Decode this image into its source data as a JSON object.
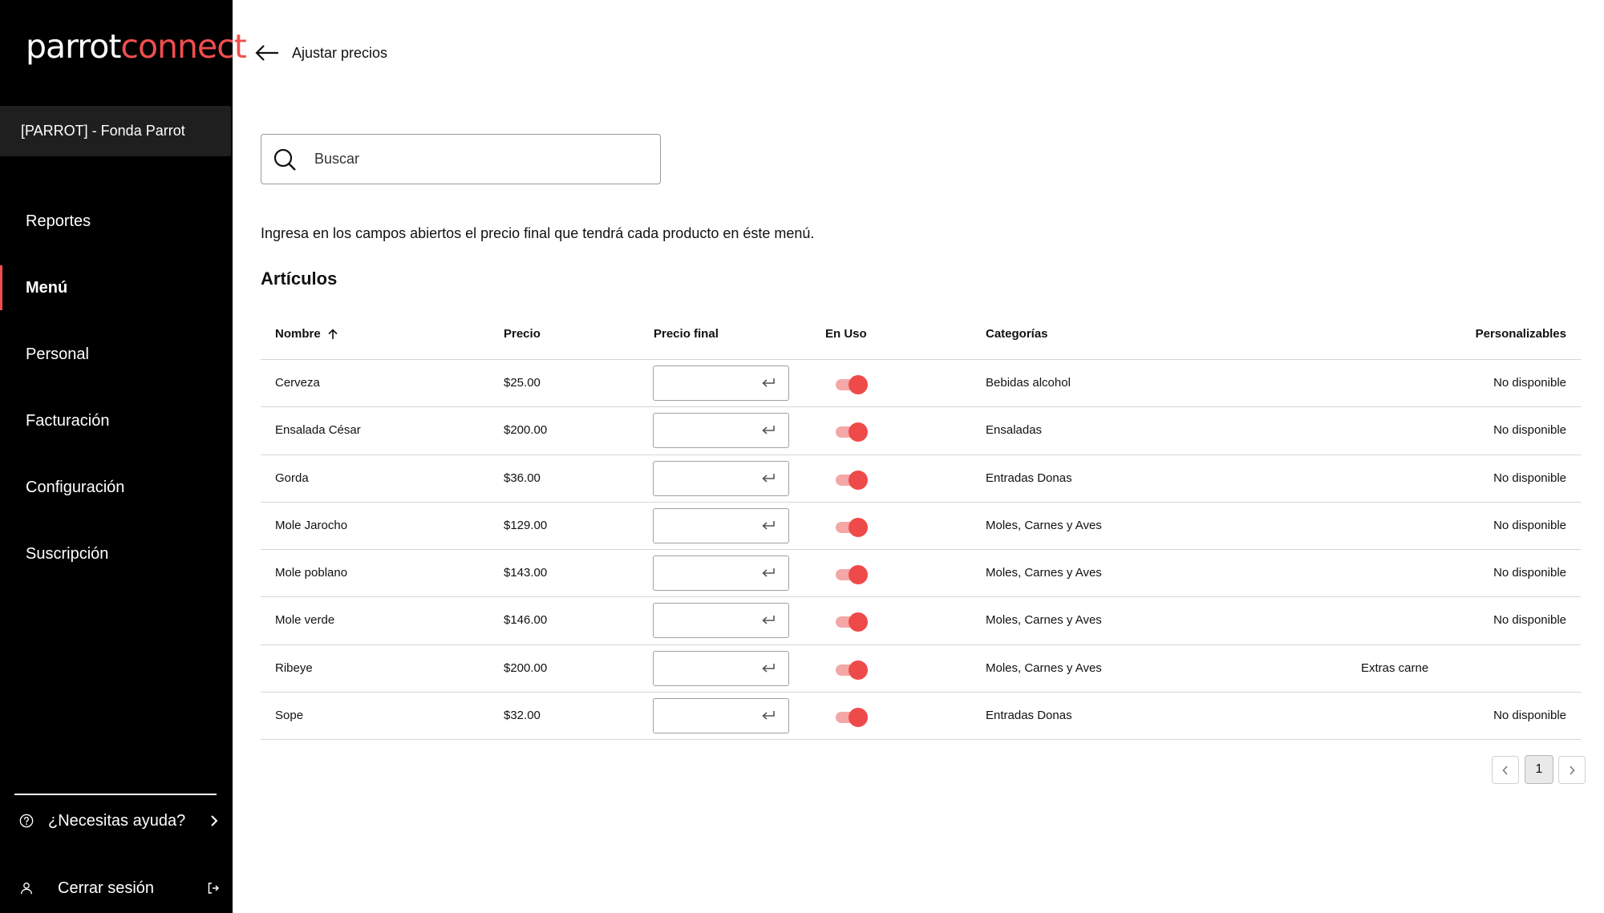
{
  "brand": {
    "logo_part1": "parrot",
    "logo_part2": "connect",
    "accent_color": "#f04e4e"
  },
  "sidebar": {
    "store": "[PARROT] - Fonda Parrot",
    "items": [
      {
        "label": "Reportes"
      },
      {
        "label": "Menú",
        "active": true
      },
      {
        "label": "Personal"
      },
      {
        "label": "Facturación"
      },
      {
        "label": "Configuración"
      },
      {
        "label": "Suscripción"
      }
    ],
    "help": "¿Necesitas ayuda?",
    "logout": "Cerrar sesión"
  },
  "header": {
    "title": "Ajustar precios"
  },
  "search": {
    "placeholder": "Buscar",
    "value": ""
  },
  "intro": "Ingresa en los campos abiertos el precio final que tendrá cada producto en éste menú.",
  "section_title": "Artículos",
  "table": {
    "columns": {
      "name": "Nombre",
      "price": "Precio",
      "final_price": "Precio final",
      "in_use": "En Uso",
      "categories": "Categorías",
      "customizable": "Personalizables"
    },
    "rows": [
      {
        "name": "Cerveza",
        "price": "$25.00",
        "final_price": "",
        "in_use": true,
        "category": "Bebidas alcohol",
        "customizable": "No disponible"
      },
      {
        "name": "Ensalada César",
        "price": "$200.00",
        "final_price": "",
        "in_use": true,
        "category": "Ensaladas",
        "customizable": "No disponible"
      },
      {
        "name": "Gorda",
        "price": "$36.00",
        "final_price": "",
        "in_use": true,
        "category": "Entradas Donas",
        "customizable": "No disponible"
      },
      {
        "name": "Mole Jarocho",
        "price": "$129.00",
        "final_price": "",
        "in_use": true,
        "category": "Moles, Carnes y Aves",
        "customizable": "No disponible"
      },
      {
        "name": "Mole poblano",
        "price": "$143.00",
        "final_price": "",
        "in_use": true,
        "category": "Moles, Carnes y Aves",
        "customizable": "No disponible"
      },
      {
        "name": "Mole verde",
        "price": "$146.00",
        "final_price": "",
        "in_use": true,
        "category": "Moles, Carnes y Aves",
        "customizable": "No disponible"
      },
      {
        "name": "Ribeye",
        "price": "$200.00",
        "final_price": "",
        "in_use": true,
        "category": "Moles, Carnes y Aves",
        "customizable": "Extras carne"
      },
      {
        "name": "Sope",
        "price": "$32.00",
        "final_price": "",
        "in_use": true,
        "category": "Entradas Donas",
        "customizable": "No disponible"
      }
    ]
  },
  "pagination": {
    "current_page": "1"
  }
}
